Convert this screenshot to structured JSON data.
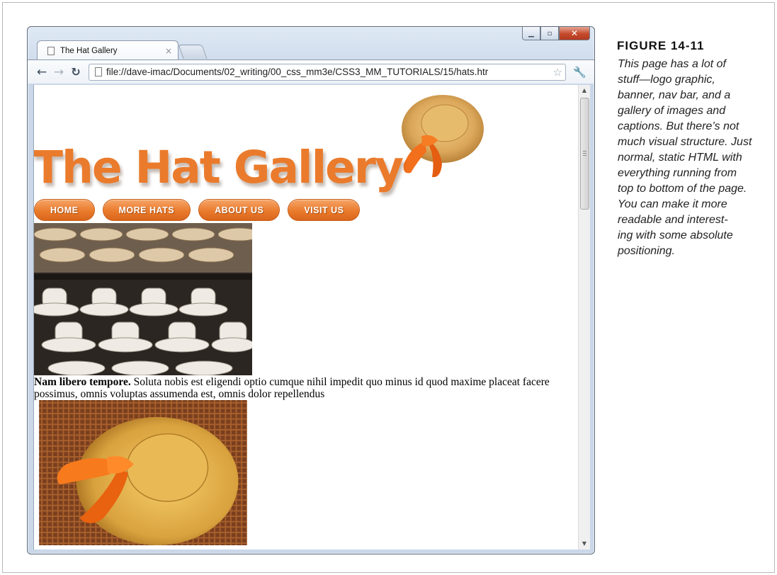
{
  "figure": {
    "label": "FIGURE 14-11",
    "caption_lines": [
      "This page has a lot of",
      "stuff—logo graphic,",
      "banner, nav bar, and a",
      "gallery of images and",
      "captions. But there’s not",
      "much visual structure. Just",
      "normal, static HTML with",
      "everything running from",
      "top to bottom of the page.",
      "You can make it more",
      "readable and interest-",
      "ing with some absolute",
      "positioning."
    ]
  },
  "browser": {
    "tab_title": "The Hat Gallery",
    "tab_close": "×",
    "url": "file://dave-imac/Documents/02_writing/00_css_mm3e/CSS3_MM_TUTORIALS/15/hats.htr",
    "back_icon": "back-arrow-icon",
    "forward_icon": "forward-arrow-icon",
    "reload_icon": "reload-icon",
    "star_icon": "bookmark-star-icon",
    "wrench_icon": "wrench-menu-icon"
  },
  "page": {
    "logo_text": "The Hat Gallery",
    "nav": [
      "HOME",
      "MORE HATS",
      "ABOUT US",
      "VISIT US"
    ],
    "captions": [
      {
        "bold": "Nam libero tempore.",
        "text": " Soluta nobis est eligendi optio cumque nihil impedit quo minus id quod maxime placeat facere possimus, omnis voluptas assumenda est, omnis dolor repellendus"
      }
    ]
  },
  "colors": {
    "brand_orange": "#ea7b2c",
    "nav_button": "#e8772c",
    "close_button": "#c54a2c"
  }
}
